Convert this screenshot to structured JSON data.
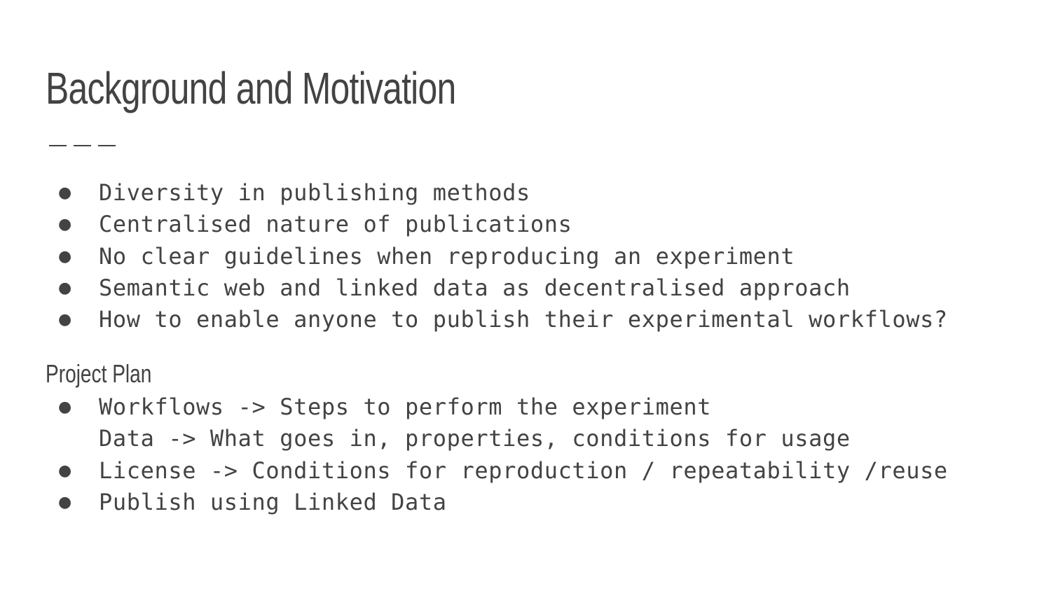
{
  "slide": {
    "title": "Background and Motivation",
    "background_items": [
      "Diversity in publishing methods",
      "Centralised nature of publications",
      "No clear guidelines when reproducing an experiment",
      "Semantic web and linked data as decentralised approach",
      "How to enable anyone to publish their experimental workflows?"
    ],
    "plan_heading": "Project Plan",
    "plan_items": [
      {
        "text": "Workflows -> Steps to perform the experiment",
        "bullet": true
      },
      {
        "text": "Data -> What goes in, properties, conditions for usage",
        "bullet": false
      },
      {
        "text": "License -> Conditions for reproduction / repeatability /reuse",
        "bullet": true
      },
      {
        "text": "Publish using Linked Data",
        "bullet": true
      }
    ],
    "bullet_glyph": "●",
    "text_color": "#434343",
    "background_color": "#ffffff"
  }
}
